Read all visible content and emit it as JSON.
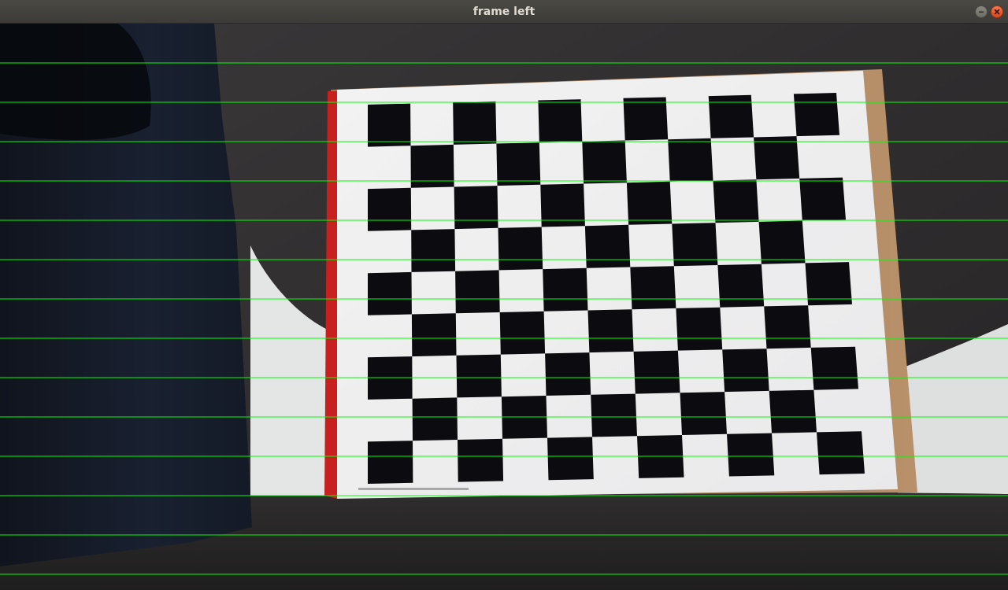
{
  "window": {
    "title": "frame left",
    "controls": [
      {
        "name": "minimize-button",
        "icon": "minimize-icon"
      },
      {
        "name": "close-button",
        "icon": "close-icon"
      }
    ]
  },
  "frame": {
    "content": "camera-frame",
    "checkerboard": {
      "rows": 9,
      "cols": 11
    },
    "epipolar_lines": {
      "count": 14,
      "color": "#00ff00"
    }
  },
  "colors": {
    "titlebar": "#3c3b37",
    "title_text": "#dfdbd2",
    "close_button": "#e95420",
    "guide_line": "#00ff00"
  }
}
